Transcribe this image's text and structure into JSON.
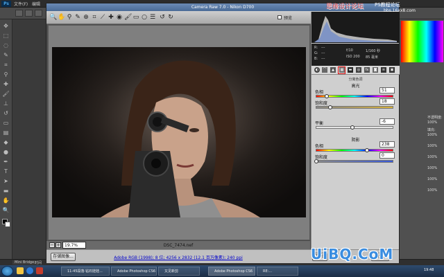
{
  "photoshop": {
    "logo": "Ps",
    "menus": [
      "文件(F)",
      "编辑"
    ],
    "minibridge": "Mini Bridge",
    "minibridge_tab2": "时间"
  },
  "camera_raw": {
    "title": "Camera Raw 7.0 - Nikon D700",
    "preview_label": "预览",
    "zoom_level": "19.7%",
    "filename": "DSC_7474.nef",
    "workflow_link": "Adobe RGB (1998); 8 位; 4256 x 2832 (12.1 百万像素); 240 ppi",
    "save_button": "存储图像...",
    "open_button": "打开图",
    "done_button": "完成",
    "hist_info": {
      "r_label": "R:",
      "r_value": "---",
      "g_label": "G:",
      "g_value": "---",
      "b_label": "B:",
      "b_value": "---",
      "aperture": "f/10",
      "shutter": "1/160 秒",
      "iso": "ISO 200",
      "focal": "85 毫米"
    },
    "panel_title": "分离色调",
    "highlights": {
      "heading": "高光",
      "hue_label": "色相",
      "hue_value": "51",
      "saturation_label": "饱和度",
      "saturation_value": "18"
    },
    "balance": {
      "label": "平衡",
      "value": "-6"
    },
    "shadows": {
      "heading": "阴影",
      "hue_label": "色相",
      "hue_value": "238",
      "saturation_label": "饱和度",
      "saturation_value": "0"
    }
  },
  "ps_right_panel": {
    "labels": [
      "不透明度:",
      "100%",
      "填充:",
      "100%",
      "100%",
      "100%",
      "100%",
      "100%",
      "100%"
    ]
  },
  "taskbar": {
    "items": [
      "11-45段落·钻石娃娃...",
      "Adobe Photoshop CS6",
      "又见新剪",
      "Adobe Photoshop CS6",
      "RE:..."
    ],
    "clock": "19:48"
  },
  "watermarks": {
    "top_left": "思缘设计论坛",
    "top_right": "PS教程论坛",
    "top_right_url": "bbs.16xx8.com",
    "bottom_right": "UiBQ.CoM"
  },
  "colors": {
    "dialog_title": "#5878a4",
    "link": "#0000cc",
    "highlight_box": "#e01010",
    "watermark": "#3a8de0"
  }
}
